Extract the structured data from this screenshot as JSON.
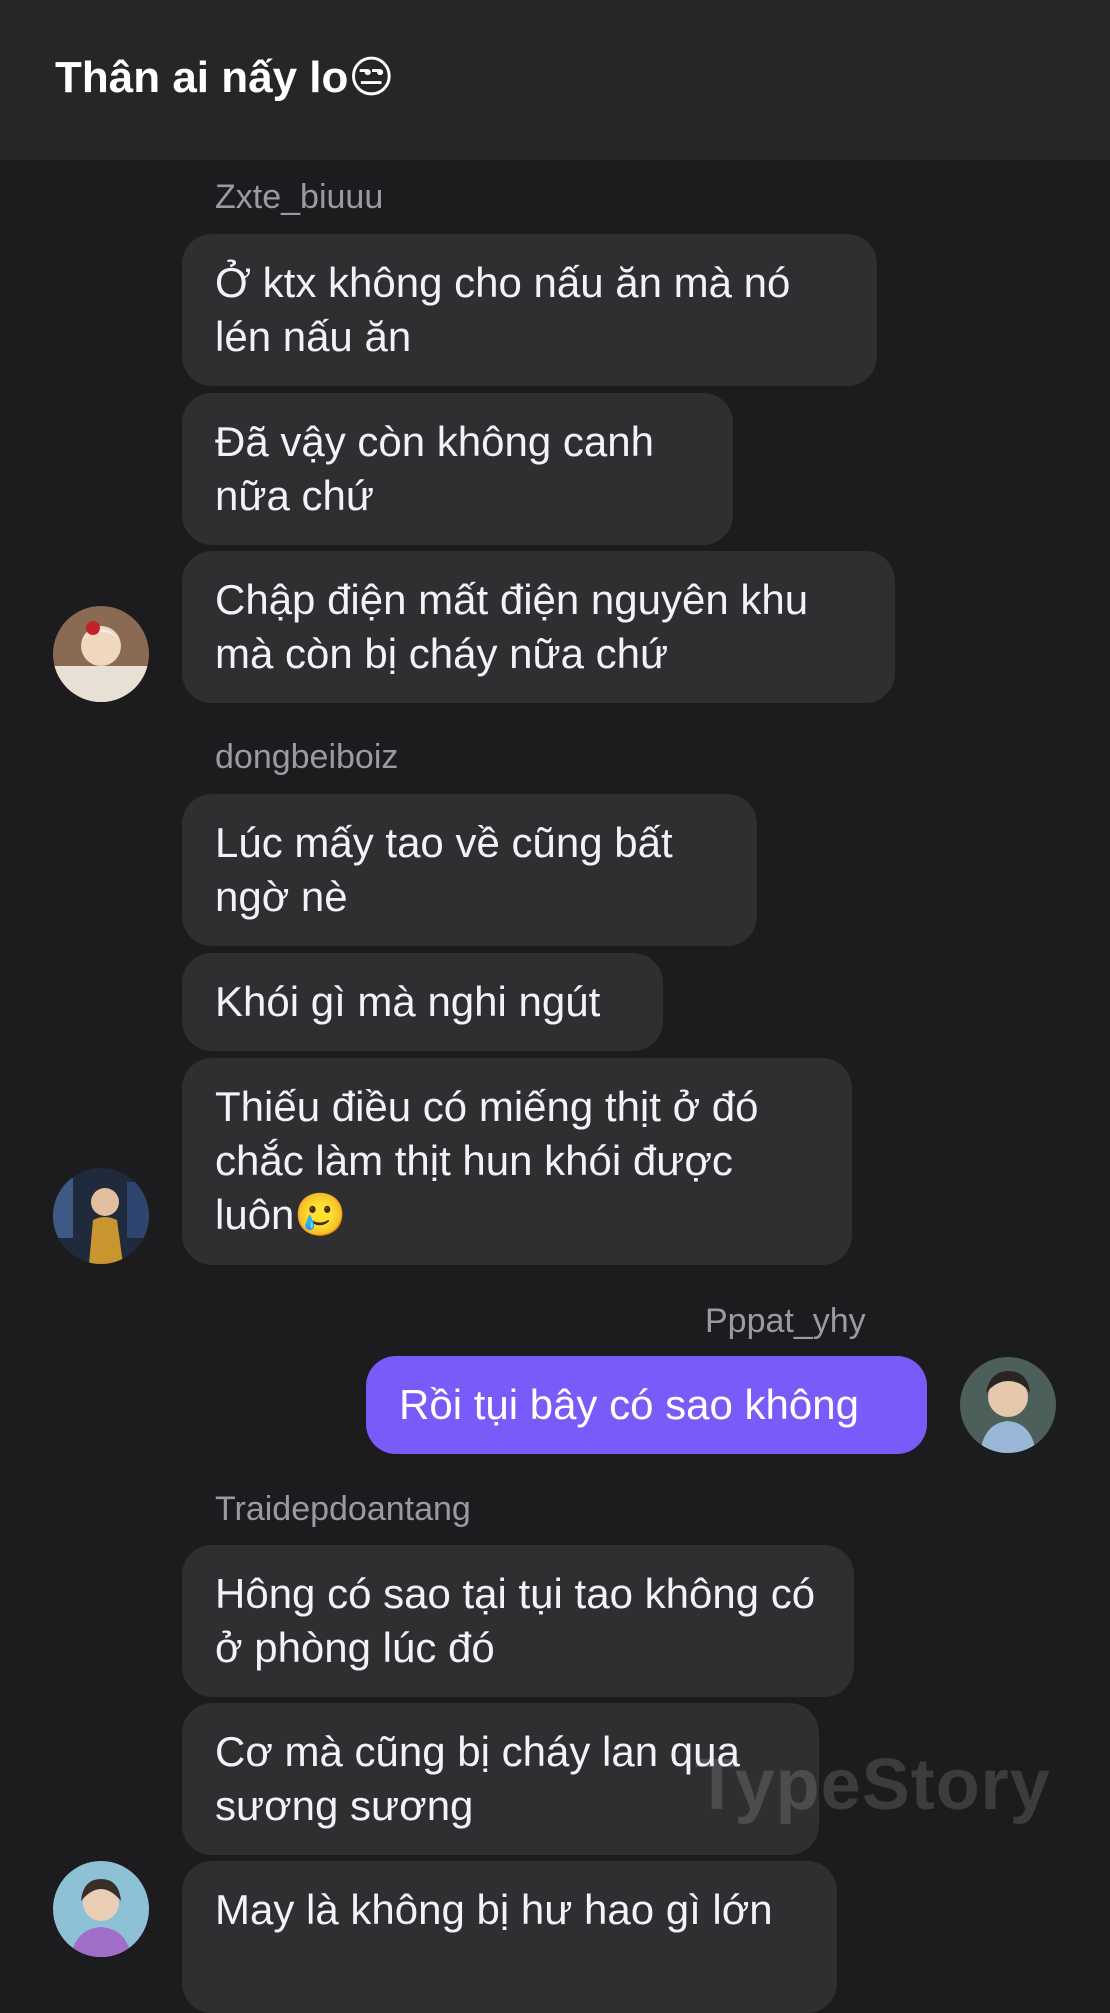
{
  "header": {
    "title": "Thân ai nấy lo😒"
  },
  "groups": [
    {
      "sender": "Zxte_biuuu",
      "messages": [
        "Ở ktx không cho nấu ăn mà nó lén nấu ăn",
        "Đã vậy còn không canh nữa chứ",
        "Chập điện mất điện nguyên khu mà còn bị cháy nữa chứ"
      ]
    },
    {
      "sender": "dongbeiboiz",
      "messages": [
        "Lúc mấy tao về cũng bất ngờ nè",
        "Khói gì mà nghi ngút",
        "Thiếu điều có miếng thịt ở đó chắc làm thịt hun khói được luôn🥲"
      ]
    },
    {
      "sender": "Pppat_yhy",
      "messages": [
        "Rồi tụi bây có sao không"
      ]
    },
    {
      "sender": "Traidepdoantang",
      "messages": [
        "Hông có sao tại tụi tao không có ở phòng lúc đó",
        "Cơ mà cũng bị cháy lan qua sương sương",
        "May là không bị hư hao gì lớn"
      ]
    }
  ],
  "watermark": "TypeStory",
  "colors": {
    "background": "#1c1c1e",
    "header": "#262628",
    "bubble_other": "#2f2f31",
    "bubble_own": "#7a5af8",
    "sender_name": "#9a9aa0"
  },
  "avatars": [
    {
      "group": "Zxte_biuuu",
      "icon": "user-avatar-photo"
    },
    {
      "group": "dongbeiboiz",
      "icon": "user-avatar-photo"
    },
    {
      "group": "Pppat_yhy",
      "icon": "user-avatar-photo"
    },
    {
      "group": "Traidepdoantang",
      "icon": "user-avatar-photo"
    }
  ]
}
